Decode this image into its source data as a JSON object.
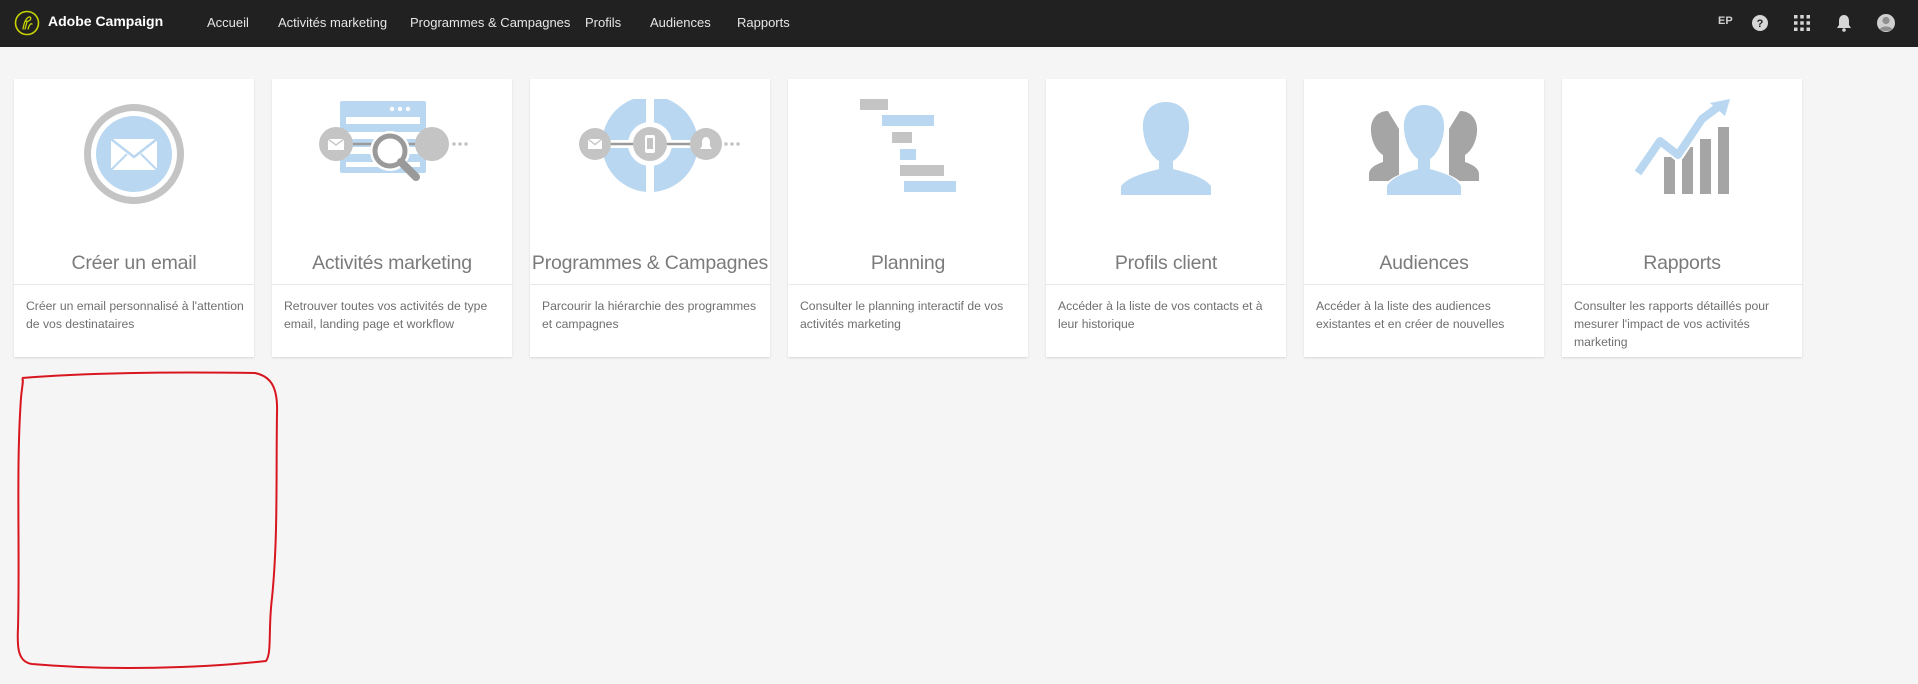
{
  "app": {
    "name": "Adobe Campaign"
  },
  "nav": {
    "items": [
      {
        "label": "Accueil"
      },
      {
        "label": "Activités marketing"
      },
      {
        "label": "Programmes & Campagnes"
      },
      {
        "label": "Profils"
      },
      {
        "label": "Audiences"
      },
      {
        "label": "Rapports"
      }
    ]
  },
  "user": {
    "initials": "EP"
  },
  "icons": {
    "help": "help-icon",
    "apps": "apps-grid-icon",
    "notifications": "bell-icon",
    "avatar": "user-avatar-icon"
  },
  "cards": [
    {
      "title": "Créer un email",
      "description": "Créer un email personnalisé à l'attention de vos destinataires",
      "illustration": "email-icon"
    },
    {
      "title": "Activités marketing",
      "description": "Retrouver toutes vos activités de type email, landing page et workflow",
      "illustration": "marketing-activities-icon"
    },
    {
      "title": "Programmes & Campagnes",
      "description": "Parcourir la hiérarchie des programmes et campagnes",
      "illustration": "programs-campaigns-icon"
    },
    {
      "title": "Planning",
      "description": "Consulter le planning interactif de vos activités marketing",
      "illustration": "planning-gantt-icon"
    },
    {
      "title": "Profils client",
      "description": "Accéder à la liste de vos contacts et à leur historique",
      "illustration": "profile-icon"
    },
    {
      "title": "Audiences",
      "description": "Accéder à la liste des audiences existantes et en créer de nouvelles",
      "illustration": "audiences-icon"
    },
    {
      "title": "Rapports",
      "description": "Consulter les rapports détaillés pour mesurer l'impact de vos activités marketing",
      "illustration": "reports-chart-icon"
    }
  ],
  "colors": {
    "topbar": "#212121",
    "background": "#f5f5f5",
    "illustration_blue": "#b9d7f0",
    "illustration_gray": "#c4c4c4",
    "annotation_red": "#d8161f"
  }
}
